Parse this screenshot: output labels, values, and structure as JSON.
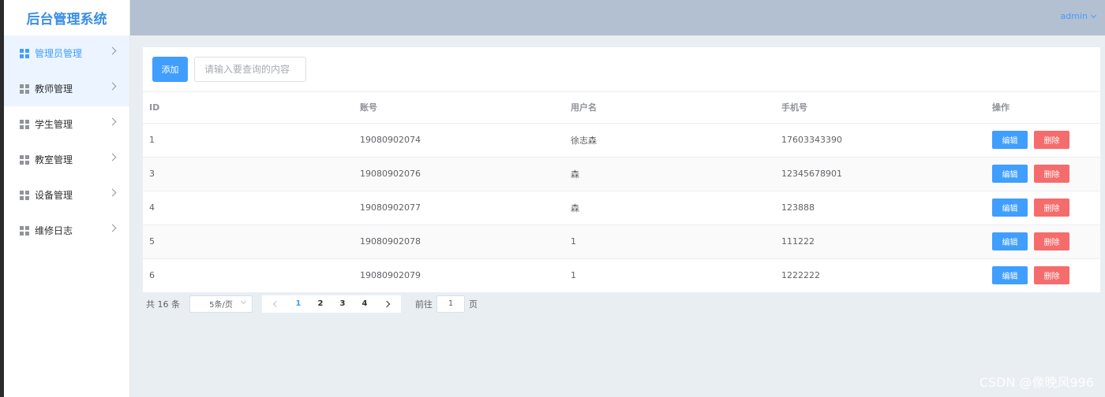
{
  "app": {
    "title": "后台管理系统"
  },
  "sidebar": {
    "items": [
      {
        "label": "管理员管理"
      },
      {
        "label": "教师管理"
      },
      {
        "label": "学生管理"
      },
      {
        "label": "教室管理"
      },
      {
        "label": "设备管理"
      },
      {
        "label": "维修日志"
      }
    ]
  },
  "header": {
    "user": "admin"
  },
  "toolbar": {
    "add_label": "添加",
    "search_placeholder": "请输入要查询的内容"
  },
  "table": {
    "headers": [
      "ID",
      "账号",
      "用户名",
      "手机号",
      "操作"
    ],
    "rows": [
      [
        "1",
        "19080902074",
        "徐志森",
        "17603343390"
      ],
      [
        "3",
        "19080902076",
        "森",
        "12345678901"
      ],
      [
        "4",
        "19080902077",
        "森",
        "123888"
      ],
      [
        "5",
        "19080902078",
        "1",
        "111222"
      ],
      [
        "6",
        "19080902079",
        "1",
        "1222222"
      ]
    ],
    "edit_label": "编辑",
    "delete_label": "删除"
  },
  "pagination": {
    "total": "共 16 条",
    "page_size": "5条/页",
    "pages": [
      "1",
      "2",
      "3",
      "4"
    ],
    "current_page": 1,
    "goto_prefix": "前往",
    "goto_value": "1",
    "goto_suffix": "页"
  },
  "watermark": "CSDN @像晚风996",
  "colors": {
    "primary": "#409eff",
    "danger": "#f56c6c",
    "header_bg": "#b3c0d1",
    "main_bg": "#e9eef3"
  },
  "icons": {
    "menu": "grid-icon",
    "submenu": "chevron-right-icon",
    "user_menu": "chevron-down-icon"
  }
}
